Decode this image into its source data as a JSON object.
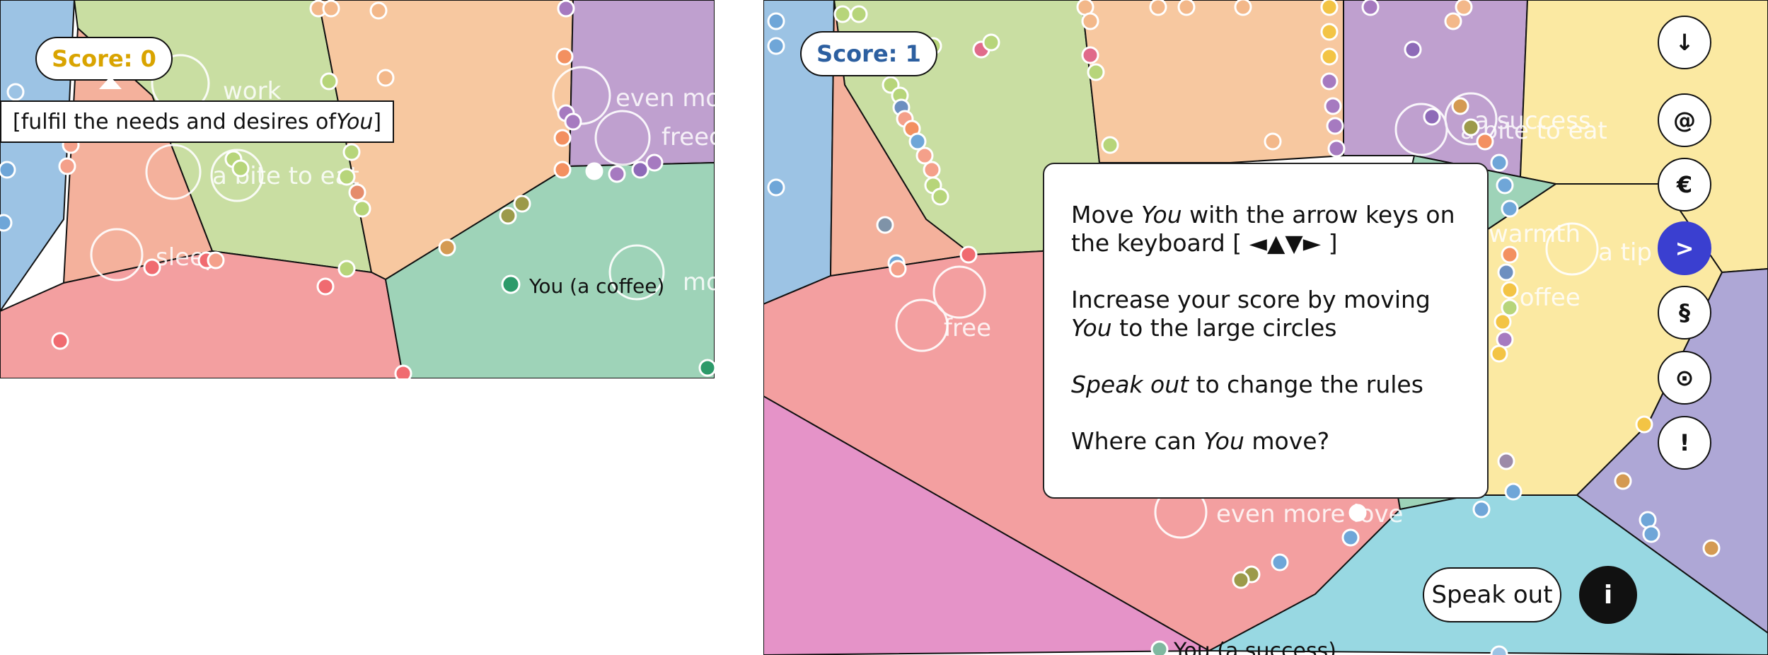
{
  "left_view": {
    "score_label": "Score: 0",
    "score_color": "#d9a400",
    "tooltip": {
      "prefix": "[fulfil the needs and desires of ",
      "emphasis": "You",
      "suffix": "]"
    },
    "you_label": "You (a coffee)",
    "faded_labels": [
      "work",
      "a bite to eat",
      "sleep",
      "even more love",
      "freedom",
      "more"
    ]
  },
  "right_view": {
    "score_label": "Score: 1",
    "score_color": "#2c5fa0",
    "faded_labels": [
      "a success",
      "a bite to eat",
      "warmth",
      "a tip out",
      "free",
      "coffee",
      "even more love",
      "You (a success)"
    ],
    "info_panel": {
      "line1_prefix": "Move ",
      "line1_em": "You",
      "line1_suffix": " with the arrow keys on the keyboard [ ◄▲▼► ]",
      "line2_prefix": "Increase your score by moving ",
      "line2_em": "You",
      "line2_suffix": " to the large circles",
      "line3_em": "Speak out",
      "line3_suffix": " to change the rules",
      "line4_prefix": "Where can ",
      "line4_em": "You",
      "line4_suffix": " move?"
    },
    "rule_buttons": [
      {
        "name": "down-arrow",
        "glyph": "↓",
        "active": false
      },
      {
        "name": "at",
        "glyph": "@",
        "active": false
      },
      {
        "name": "euro",
        "glyph": "€",
        "active": false
      },
      {
        "name": "next",
        "glyph": ">",
        "active": true
      },
      {
        "name": "section",
        "glyph": "§",
        "active": false
      },
      {
        "name": "target",
        "glyph": "⊙",
        "active": false
      },
      {
        "name": "exclamation",
        "glyph": "!",
        "active": false
      }
    ],
    "speak_out_label": "Speak out",
    "info_label": "i"
  },
  "region_colors": {
    "blue": "#9cc3e4",
    "green": "#c9dea2",
    "orange": "#f7c8a0",
    "purple": "#bfa0cf",
    "salmon": "#f4b19c",
    "red": "#f39fa0",
    "teal": "#9ed3b8",
    "yellow": "#fbe9a2",
    "violet": "#aea7d6",
    "pink": "#e593c8",
    "cyan": "#98d8e2"
  }
}
